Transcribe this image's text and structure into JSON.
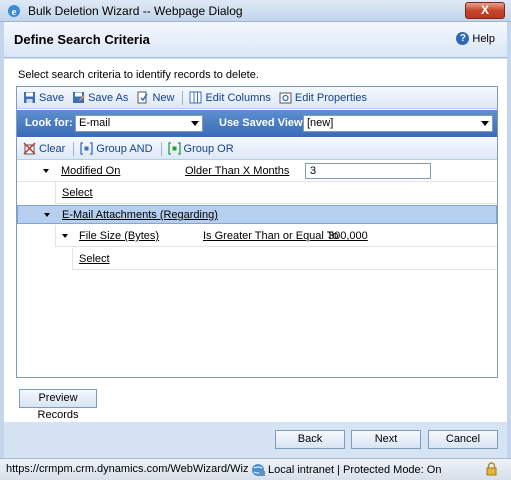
{
  "window": {
    "title": "Bulk Deletion Wizard -- Webpage Dialog",
    "close_label": "X"
  },
  "header": {
    "title": "Define Search Criteria",
    "help_label": "Help"
  },
  "instructions": "Select search criteria to identify records to delete.",
  "toolbar": {
    "save": "Save",
    "save_as": "Save As",
    "new": "New",
    "edit_columns": "Edit Columns",
    "edit_properties": "Edit Properties"
  },
  "look_for": {
    "label": "Look for:",
    "value": "E-mail"
  },
  "saved_view": {
    "label": "Use Saved View:",
    "value": "[new]"
  },
  "group_toolbar": {
    "clear": "Clear",
    "group_and": "Group AND",
    "group_or": "Group OR"
  },
  "criteria": {
    "row1": {
      "field": "Modified On",
      "operator": "Older Than X Months",
      "value": "3"
    },
    "select1": "Select",
    "related": "E-Mail Attachments (Regarding)",
    "row2": {
      "field": "File Size (Bytes)",
      "operator": "Is Greater Than or Equal To",
      "value": "300,000"
    },
    "select2": "Select"
  },
  "preview_button": "Preview Records",
  "footer": {
    "back": "Back",
    "next": "Next",
    "cancel": "Cancel"
  },
  "status": {
    "url": "https://crmpm.crm.dynamics.com/WebWizard/Wizard",
    "zone": "Local intranet | Protected Mode: On"
  }
}
